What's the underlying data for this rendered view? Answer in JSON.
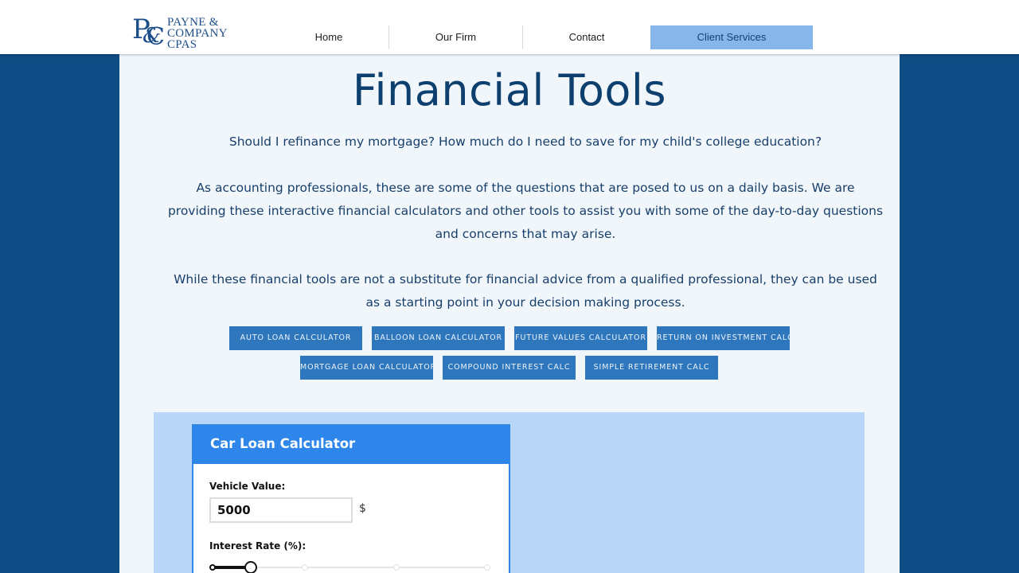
{
  "brand": {
    "logo_mark": {
      "p": "P",
      "amp": "&",
      "c": "C"
    },
    "lines": [
      "PAYNE &",
      "COMPANY",
      "CPAS"
    ]
  },
  "nav": {
    "items": [
      {
        "label": "Home"
      },
      {
        "label": "Our Firm"
      },
      {
        "label": "Contact"
      },
      {
        "label": "Client Services",
        "active": true
      }
    ]
  },
  "page": {
    "title": "Financial Tools",
    "intro": "Should I refinance my mortgage? How much do I need to save for my child's college education?",
    "body": "As accounting professionals, these are some of the questions that are posed to us on a daily basis. We are providing these interactive financial calculators and other tools to assist you with some of the day-to-day questions and concerns that may arise.",
    "disclaimer": "While these financial tools are not a substitute for financial advice from a qualified professional, they can be used as a starting point in your decision making process."
  },
  "tools": {
    "auto_loan": "AUTO LOAN CALCULATOR",
    "balloon_loan": "BALLOON LOAN CALCULATOR",
    "future_values": "FUTURE VALUES CALCULATOR",
    "return_on_investment": "RETURN ON INVESTMENT CALC",
    "mortgage_loan": "MORTGAGE LOAN CALCULATOR",
    "compound_interest": "COMPOUND INTEREST CALC",
    "simple_retirement": "SIMPLE RETIREMENT CALC"
  },
  "calculator": {
    "title": "Car Loan Calculator",
    "vehicle_value_label": "Vehicle Value:",
    "vehicle_value": "5000",
    "currency_unit": "$",
    "interest_rate_label": "Interest Rate (%):",
    "interest_rate_slider_fraction": 0.14
  },
  "colors": {
    "background": "#0f4c85",
    "accent": "#2f86ea",
    "nav_active": "#86b6ea",
    "tool_button": "#2f77bd",
    "calc_panel": "#b8d6f8"
  }
}
